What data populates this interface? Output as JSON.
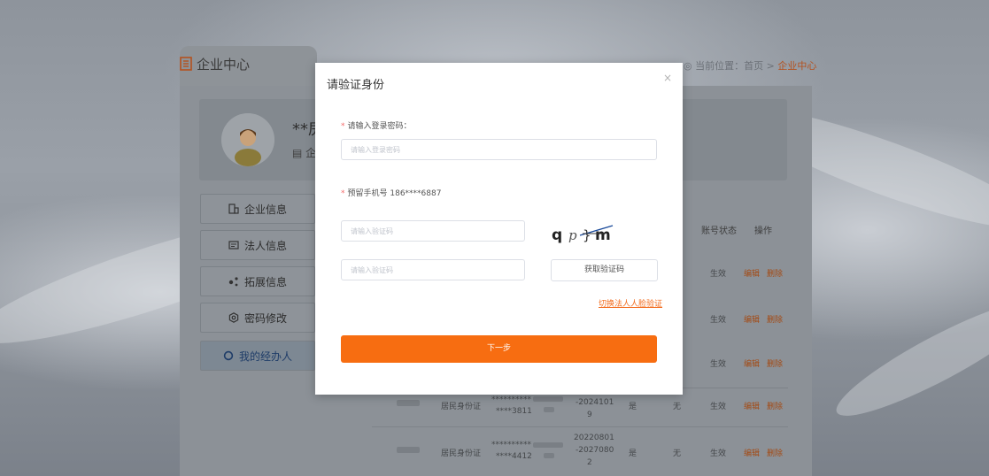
{
  "page": {
    "tab_title": "企业中心",
    "breadcrumb": {
      "prefix": "当前位置：",
      "home": "首页",
      "sep": " > ",
      "current": "企业中心"
    },
    "profile": {
      "name": "**房",
      "sub": "企"
    },
    "menu": [
      {
        "label": "企业信息",
        "icon": "building-icon"
      },
      {
        "label": "法人信息",
        "icon": "id-card-icon"
      },
      {
        "label": "拓展信息",
        "icon": "share-icon"
      },
      {
        "label": "密码修改",
        "icon": "gear-icon"
      },
      {
        "label": "我的经办人",
        "icon": "circle-icon"
      }
    ],
    "table": {
      "headers": {
        "status": "账号状态",
        "ops": "操作"
      },
      "rows": [
        {
          "status": "生效",
          "edit": "编辑",
          "del": "删除"
        },
        {
          "status": "生效",
          "edit": "编辑",
          "del": "删除"
        },
        {
          "status": "生效",
          "edit": "编辑",
          "del": "删除"
        },
        {
          "idtype": "居民身份证",
          "idno": "****3811",
          "validity": [
            "-2024101",
            "9"
          ],
          "col_a": "是",
          "col_b": "无",
          "status": "生效",
          "edit": "编辑",
          "del": "删除"
        },
        {
          "idtype": "居民身份证",
          "idno": "****4412",
          "validity": [
            "20220801",
            "-2027080",
            "2"
          ],
          "col_a": "是",
          "col_b": "无",
          "status": "生效",
          "edit": "编辑",
          "del": "删除"
        }
      ]
    }
  },
  "modal": {
    "title": "请验证身份",
    "close": "×",
    "password_label": "请输入登录密码：",
    "password_placeholder": "请输入登录密码",
    "phone_label": "预留手机号 186****6887",
    "captcha_placeholder": "请输入验证码",
    "captcha_text": "q p ╪m",
    "sms_placeholder": "请输入验证码",
    "sms_button": "获取验证码",
    "switch_link": "切换法人人脸验证",
    "next_button": "下一步"
  },
  "colors": {
    "accent": "#f76d11",
    "link": "#f26b1d",
    "required": "#f56c6c"
  }
}
